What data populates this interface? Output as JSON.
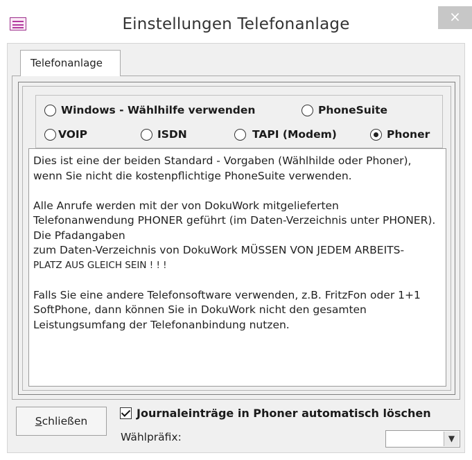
{
  "window": {
    "title": "Einstellungen Telefonanlage",
    "close_glyph": "×"
  },
  "tab": {
    "label": "Telefonanlage"
  },
  "options": [
    {
      "label": "Windows - Wählhilfe  verwenden",
      "checked": false
    },
    {
      "label": "PhoneSuite",
      "checked": false
    },
    {
      "label": "VOIP",
      "checked": false
    },
    {
      "label": "ISDN",
      "checked": false
    },
    {
      "label": "TAPI (Modem)",
      "checked": false
    },
    {
      "label": "Phoner",
      "checked": true
    }
  ],
  "info_text": {
    "para1": "Dies ist eine der beiden Standard - Vorgaben (Wählhilde oder Phoner), wenn Sie nicht die kostenpflichtige PhoneSuite verwenden.",
    "para2_line1": "Alle Anrufe werden mit der von DokuWork mitgelieferten Telefonanwendung PHONER geführt (im Daten-Verzeichnis unter PHONER). Die Pfadangaben",
    "para2_line2": "zum Daten-Verzeichnis von DokuWork MÜSSEN VON JEDEM ARBEITS-",
    "para2_line3": "PLATZ AUS GLEICH SEIN ! ! !",
    "para3": "Falls Sie eine andere Telefonsoftware verwenden, z.B. FritzFon oder 1+1 SoftPhone, dann können Sie in DokuWork nicht den gesamten Leistungsumfang der Telefonanbindung nutzen."
  },
  "footer": {
    "close_button": "Schließen",
    "journal_checkbox_label": "Journaleinträge in Phoner automatisch löschen",
    "journal_checked": true,
    "prefix_label": "Wählpräfix:",
    "prefix_value": ""
  },
  "icons": {
    "app": "form-icon",
    "close": "close-icon",
    "dropdown": "chevron-down-icon",
    "check": "checkmark-icon"
  }
}
